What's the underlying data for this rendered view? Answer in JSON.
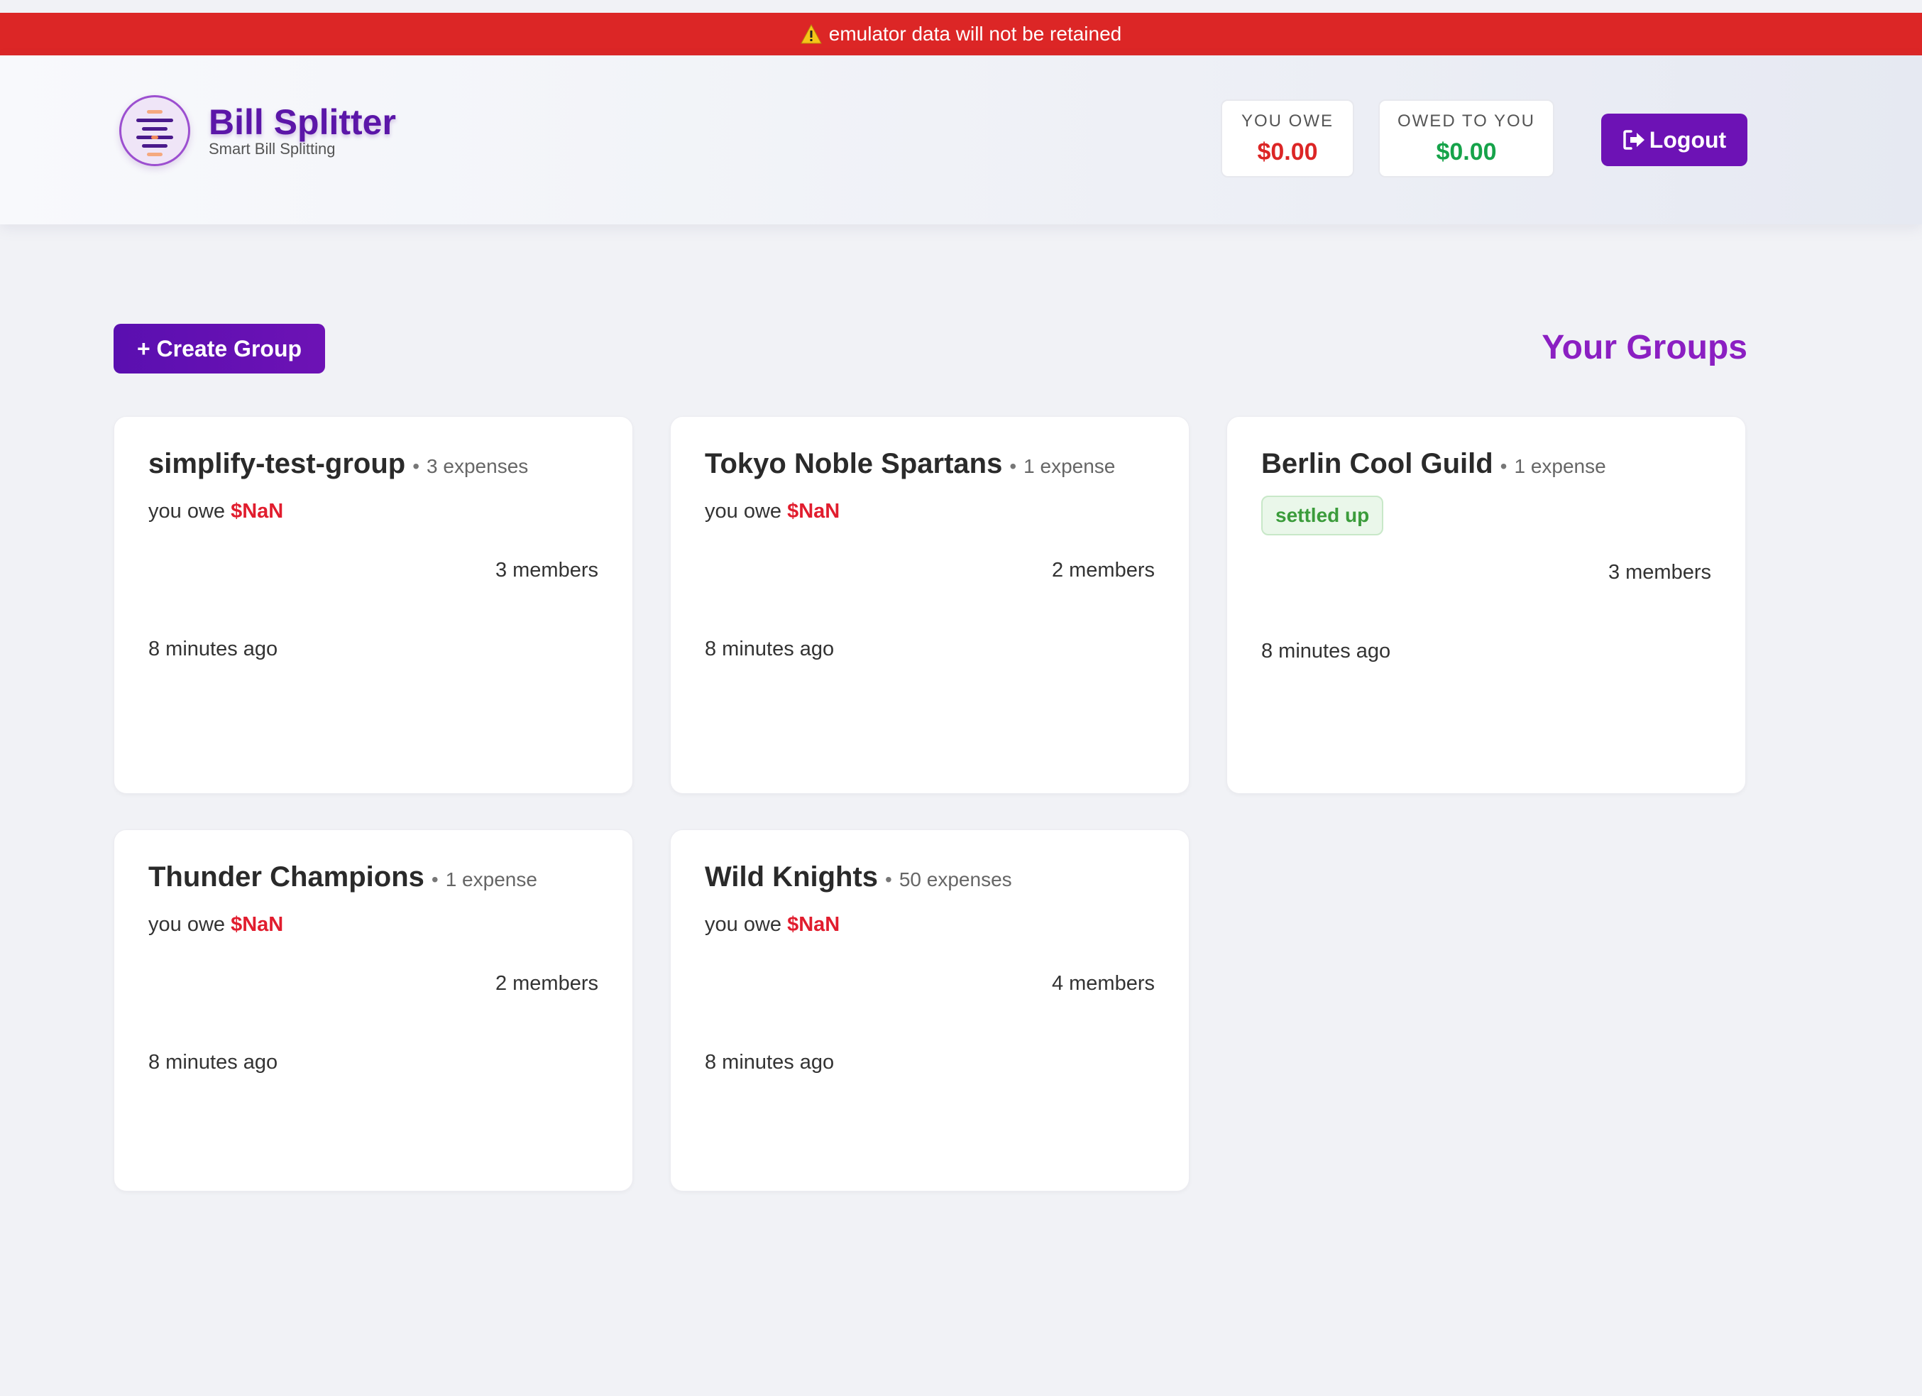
{
  "banner": {
    "text": "emulator data will not be retained",
    "icon": "warning-icon"
  },
  "header": {
    "app_name": "Bill Splitter",
    "tagline": "Smart Bill Splitting",
    "you_owe_label": "YOU OWE",
    "you_owe_value": "$0.00",
    "owed_to_you_label": "OWED TO YOU",
    "owed_to_you_value": "$0.00",
    "logout_label": "Logout"
  },
  "main": {
    "create_group_label": "+ Create Group",
    "section_title": "Your Groups",
    "groups": [
      {
        "name": "simplify-test-group",
        "expenses": "3 expenses",
        "owe_prefix": "you owe",
        "owe_amount": "$NaN",
        "members": "3 members",
        "updated": "8 minutes ago"
      },
      {
        "name": "Tokyo Noble Spartans",
        "expenses": "1 expense",
        "owe_prefix": "you owe",
        "owe_amount": "$NaN",
        "members": "2 members",
        "updated": "8 minutes ago"
      },
      {
        "name": "Berlin Cool Guild",
        "expenses": "1 expense",
        "status": "settled up",
        "members": "3 members",
        "updated": "8 minutes ago"
      },
      {
        "name": "Thunder Champions",
        "expenses": "1 expense",
        "owe_prefix": "you owe",
        "owe_amount": "$NaN",
        "members": "2 members",
        "updated": "8 minutes ago"
      },
      {
        "name": "Wild Knights",
        "expenses": "50 expenses",
        "owe_prefix": "you owe",
        "owe_amount": "$NaN",
        "members": "4 members",
        "updated": "8 minutes ago"
      }
    ]
  },
  "colors": {
    "banner": "#dc2626",
    "brand": "#5b16a8",
    "accent": "#6d12b5",
    "debt": "#dc2626",
    "credit": "#16a34a",
    "settled": "#3b9c3b"
  }
}
